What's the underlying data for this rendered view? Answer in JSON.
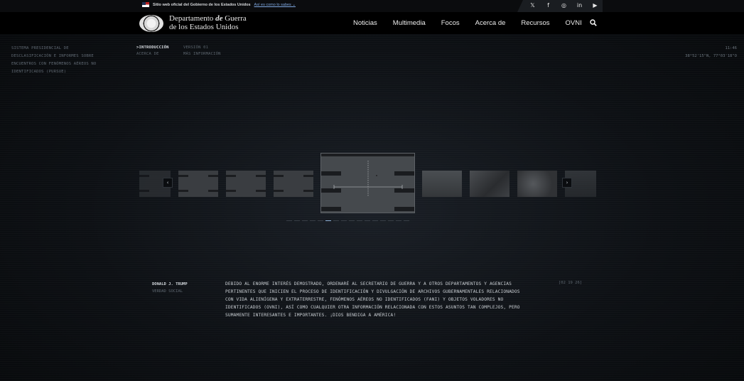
{
  "gov_banner": {
    "text": "Sitio web oficial del Gobierno de los Estados Unidos",
    "link": "Así es como lo sabes ⌄"
  },
  "social": [
    "𝕏",
    "f",
    "◎",
    "in",
    "▶"
  ],
  "header": {
    "logo_line1_a": "Departamento",
    "logo_line1_de": "de",
    "logo_line1_b": "Guerra",
    "logo_line2": "de los Estados Unidos",
    "nav": [
      "Noticias",
      "Multimedia",
      "Focos",
      "Acerca de",
      "Recursos",
      "OVNI"
    ]
  },
  "system_title": "SISTEMA PRESIDENCIAL DE DESCLASIFICACIÓN E INFORMES SOBRE ENCUENTROS CON FENÓMENOS AÉREOS NO IDENTIFICADOS (PURSUE)",
  "menu": {
    "intro": ">INTRODUCCIÓN",
    "about": "ACERCA DE",
    "version": "VERSIÓN 01",
    "more": "MÁS INFORMACIÓN"
  },
  "clock": {
    "time": "11:46",
    "coords": "38°52'15\"N, 77°03'18\"O"
  },
  "carousel": {
    "prev": "‹",
    "next": "›",
    "slides": 16,
    "active_slide": 5
  },
  "quote": {
    "author": "DONALD J. TRUMP",
    "source": "VERDAD SOCIAL",
    "text": "DEBIDO AL ENORME INTERÉS DEMOSTRADO, ORDENARÉ AL SECRETARIO DE GUERRA Y A OTROS DEPARTAMENTOS Y AGENCIAS PERTINENTES QUE INICIEN EL PROCESO DE IDENTIFICACIÓN Y DIVULGACIÓN DE ARCHIVOS GUBERNAMENTALES RELACIONADOS CON VIDA ALIENÍGENA Y EXTRATERRESTRE, FENÓMENOS AÉREOS NO IDENTIFICADOS (FANI) Y OBJETOS VOLADORES NO IDENTIFICADOS (OVNI), ASÍ COMO CUALQUIER OTRA INFORMACIÓN RELACIONADA CON ESTOS ASUNTOS TAN COMPLEJOS, PERO SUMAMENTE INTERESANTES E IMPORTANTES. ¡DIOS BENDIGA A AMÉRICA!",
    "timestamp": "[02 19 26]"
  },
  "colors": {
    "accent": "#8fb3d9",
    "background": "#0d1014",
    "text": "#c8cdd2"
  }
}
